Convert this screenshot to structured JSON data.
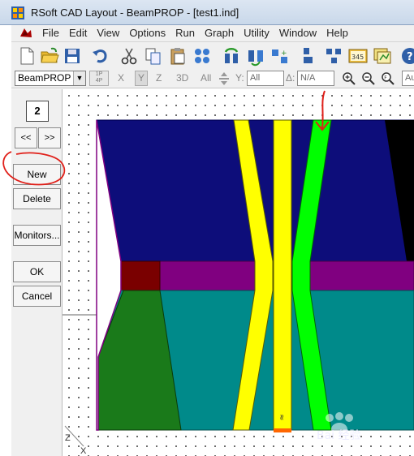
{
  "window": {
    "title": "RSoft CAD Layout - BeamPROP - [test1.ind]"
  },
  "menu": {
    "items": [
      "File",
      "Edit",
      "View",
      "Options",
      "Run",
      "Graph",
      "Utility",
      "Window",
      "Help"
    ]
  },
  "toolbar": {
    "buttons": [
      "new-file",
      "open-folder",
      "save",
      "undo",
      "cut",
      "copy",
      "paste",
      "symbol-bold",
      "rotate-group",
      "flip-group",
      "scale-group",
      "align-left",
      "align-group",
      "numbered-sequence",
      "layers",
      "help"
    ]
  },
  "toolbar2": {
    "program_select": "BeamPROP",
    "mode_1p4p_top": "1P",
    "mode_1p4p_bottom": "4P",
    "axis_x": "X",
    "axis_y": "Y",
    "axis_z": "Z",
    "view_3d": "3D",
    "all_label": "All",
    "y_label": "Y:",
    "y_value": "All",
    "delta_label": "Δ:",
    "delta_value": "N/A",
    "extra_value": "Au"
  },
  "left_panel": {
    "segment_number": "2",
    "prev_button": "<<",
    "next_button": ">>",
    "new_button": "New",
    "delete_button": "Delete",
    "monitors_button": "Monitors...",
    "ok_button": "OK",
    "cancel_button": "Cancel"
  },
  "canvas": {
    "z_axis": "Z",
    "x_axis": "X",
    "region_colors": {
      "upper_cladding": "#0d0d7a",
      "substrate": "#008a8a",
      "core_layer": "#800080",
      "dark_block": "#7a0000",
      "green_block": "#1a7a1a",
      "waveguide_yellow": "#ffff00",
      "waveguide_green": "#00ff00",
      "black_region": "#000000",
      "launch_marker": "#ff6600"
    },
    "annotation_color": "#e0201a",
    "launch_label": "≈"
  },
  "watermark": {
    "text": "Bai 经验"
  }
}
